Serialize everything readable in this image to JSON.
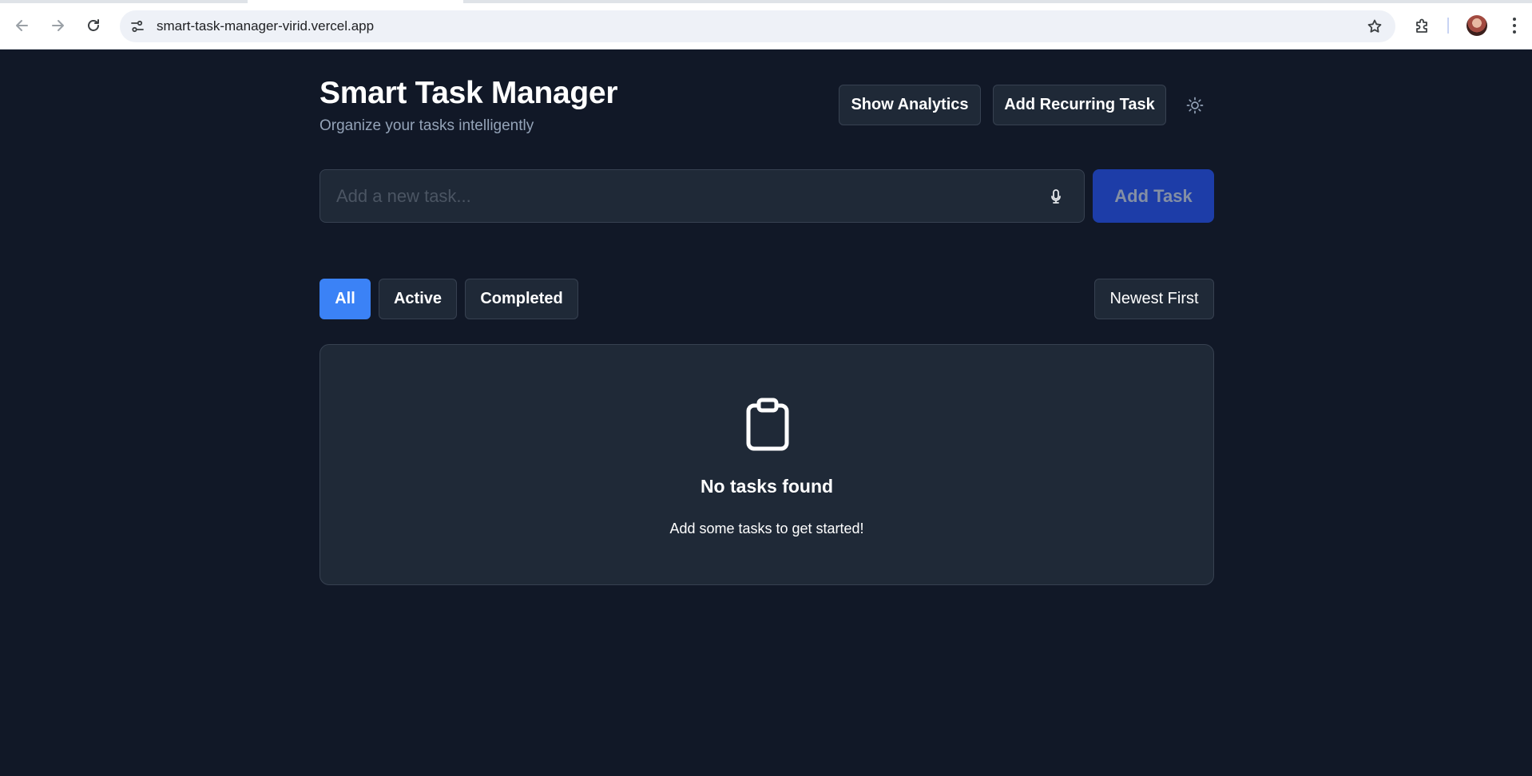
{
  "browser": {
    "url": "smart-task-manager-virid.vercel.app"
  },
  "header": {
    "title": "Smart Task Manager",
    "subtitle": "Organize your tasks intelligently",
    "show_analytics_label": "Show Analytics",
    "add_recurring_label": "Add Recurring Task"
  },
  "task_form": {
    "placeholder": "Add a new task...",
    "value": "",
    "add_label": "Add Task"
  },
  "filters": {
    "all": "All",
    "active": "Active",
    "completed": "Completed",
    "selected": "All"
  },
  "sort": {
    "selected": "Newest First"
  },
  "empty_state": {
    "title": "No tasks found",
    "message": "Add some tasks to get started!"
  },
  "icons": {
    "back": "back-arrow-icon",
    "forward": "forward-arrow-icon",
    "reload": "reload-icon",
    "site_info": "site-settings-icon",
    "bookmark": "star-icon",
    "extensions": "puzzle-icon",
    "theme": "sun-icon",
    "mic": "microphone-icon",
    "empty": "clipboard-icon"
  },
  "colors": {
    "background": "#111827",
    "surface": "#1f2937",
    "border": "#374151",
    "accent": "#3b82f6",
    "add_button": "#1e40af",
    "muted_text": "#94a3b8"
  }
}
